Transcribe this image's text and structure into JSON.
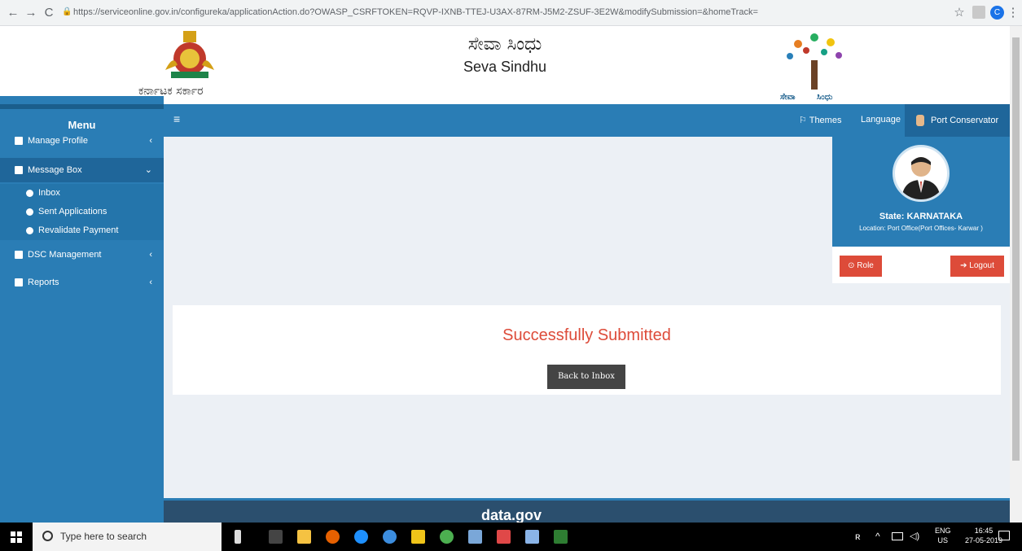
{
  "browser": {
    "url": "https://serviceonline.gov.in/configureka/applicationAction.do?OWASP_CSRFTOKEN=RQVP-IXNB-TTEJ-U3AX-87RM-J5M2-ZSUF-3E2W&modifySubmission=&homeTrack=",
    "back_icon": "←",
    "forward_icon": "→",
    "reload_icon": "C",
    "star_icon": "☆",
    "profile_initial": "C",
    "menu_icon": "⋮"
  },
  "header": {
    "gov_label": "ಕರ್ನಾಟಕ ಸರ್ಕಾರ",
    "title_kannada": "ಸೇವಾ ಸಿಂಧು",
    "title_english": "Seva Sindhu",
    "logo_kannada_left": "ಸೇವಾ",
    "logo_kannada_right": "ಸಿಂಧು"
  },
  "sidebar": {
    "menu_label": "Menu",
    "items": [
      {
        "label": "Manage Profile",
        "chev": "‹"
      },
      {
        "label": "Message Box",
        "chev": "⌄"
      },
      {
        "label": "DSC Management",
        "chev": "‹"
      },
      {
        "label": "Reports",
        "chev": "‹"
      }
    ],
    "sub_items": [
      {
        "label": "Inbox"
      },
      {
        "label": "Sent Applications"
      },
      {
        "label": "Revalidate Payment"
      }
    ]
  },
  "topnav": {
    "hamburger": "≡",
    "themes": "⚐ Themes",
    "language": "Language",
    "user": "Port Conservator"
  },
  "profile": {
    "state": "State: KARNATAKA",
    "location": "Location: Port Office(Port Offices- Karwar )",
    "role_label": "Role",
    "logout_label": "Logout"
  },
  "main": {
    "message": "Successfully Submitted",
    "back_label": "Back to Inbox"
  },
  "footer": {
    "text": "data.gov"
  },
  "taskbar": {
    "search_placeholder": "Type here to search",
    "lang_top": "ENG",
    "lang_bottom": "US",
    "time": "16:45",
    "date": "27-05-2019"
  },
  "colors": {
    "primary": "#2a7db5",
    "danger": "#dd4b39",
    "background": "#ecf0f5"
  }
}
